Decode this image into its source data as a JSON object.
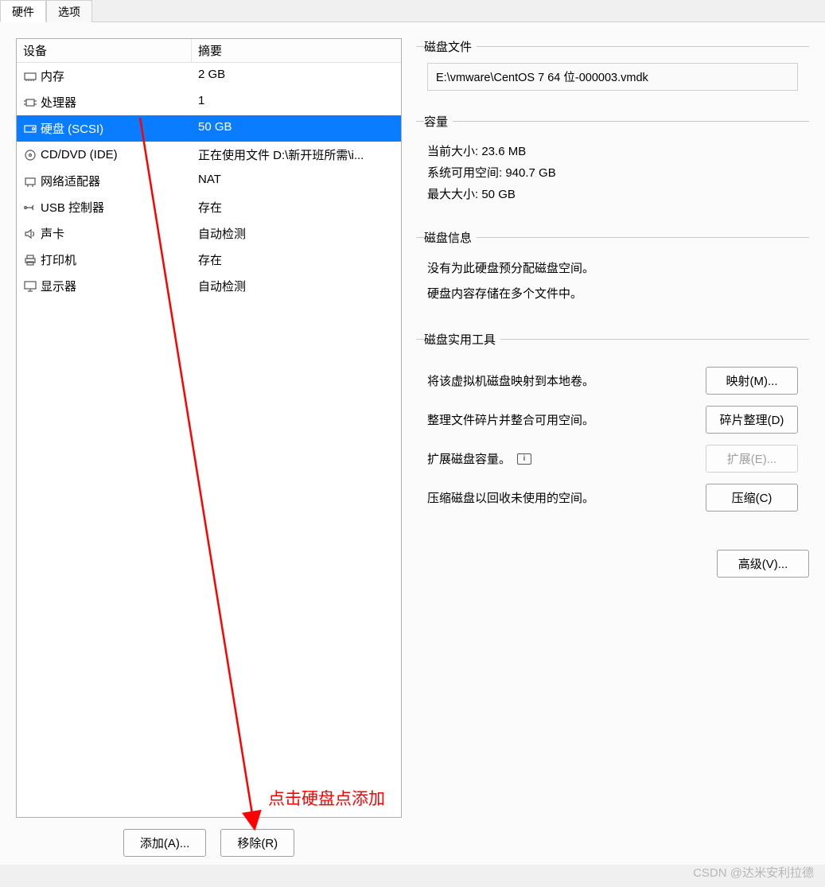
{
  "tabs": {
    "hardware": "硬件",
    "options": "选项"
  },
  "table": {
    "headers": {
      "device": "设备",
      "summary": "摘要"
    },
    "rows": [
      {
        "name": "内存",
        "summary": "2 GB",
        "icon": "memory"
      },
      {
        "name": "处理器",
        "summary": "1",
        "icon": "cpu"
      },
      {
        "name": "硬盘 (SCSI)",
        "summary": "50 GB",
        "icon": "disk",
        "selected": true
      },
      {
        "name": "CD/DVD (IDE)",
        "summary": "正在使用文件 D:\\新开班所需\\i...",
        "icon": "cd"
      },
      {
        "name": "网络适配器",
        "summary": "NAT",
        "icon": "net"
      },
      {
        "name": "USB 控制器",
        "summary": "存在",
        "icon": "usb"
      },
      {
        "name": "声卡",
        "summary": "自动检测",
        "icon": "sound"
      },
      {
        "name": "打印机",
        "summary": "存在",
        "icon": "printer"
      },
      {
        "name": "显示器",
        "summary": "自动检测",
        "icon": "display"
      }
    ]
  },
  "buttons": {
    "add": "添加(A)...",
    "remove": "移除(R)"
  },
  "diskfile": {
    "legend": "磁盘文件",
    "path": "E:\\vmware\\CentOS 7 64 位-000003.vmdk"
  },
  "capacity": {
    "legend": "容量",
    "current": {
      "label": "当前大小: ",
      "value": "23.6 MB"
    },
    "free": {
      "label": "系统可用空间: ",
      "value": "940.7 GB"
    },
    "max": {
      "label": "最大大小: ",
      "value": "50 GB"
    }
  },
  "diskinfo": {
    "legend": "磁盘信息",
    "line1": "没有为此硬盘预分配磁盘空间。",
    "line2": "硬盘内容存储在多个文件中。"
  },
  "utilities": {
    "legend": "磁盘实用工具",
    "map": {
      "desc": "将该虚拟机磁盘映射到本地卷。",
      "btn": "映射(M)..."
    },
    "defrag": {
      "desc": "整理文件碎片并整合可用空间。",
      "btn": "碎片整理(D)"
    },
    "expand": {
      "desc": "扩展磁盘容量。",
      "btn": "扩展(E)..."
    },
    "compact": {
      "desc": "压缩磁盘以回收未使用的空间。",
      "btn": "压缩(C)"
    }
  },
  "advanced": "高级(V)...",
  "annotation": "点击硬盘点添加",
  "watermark": "CSDN @达米安利拉德"
}
